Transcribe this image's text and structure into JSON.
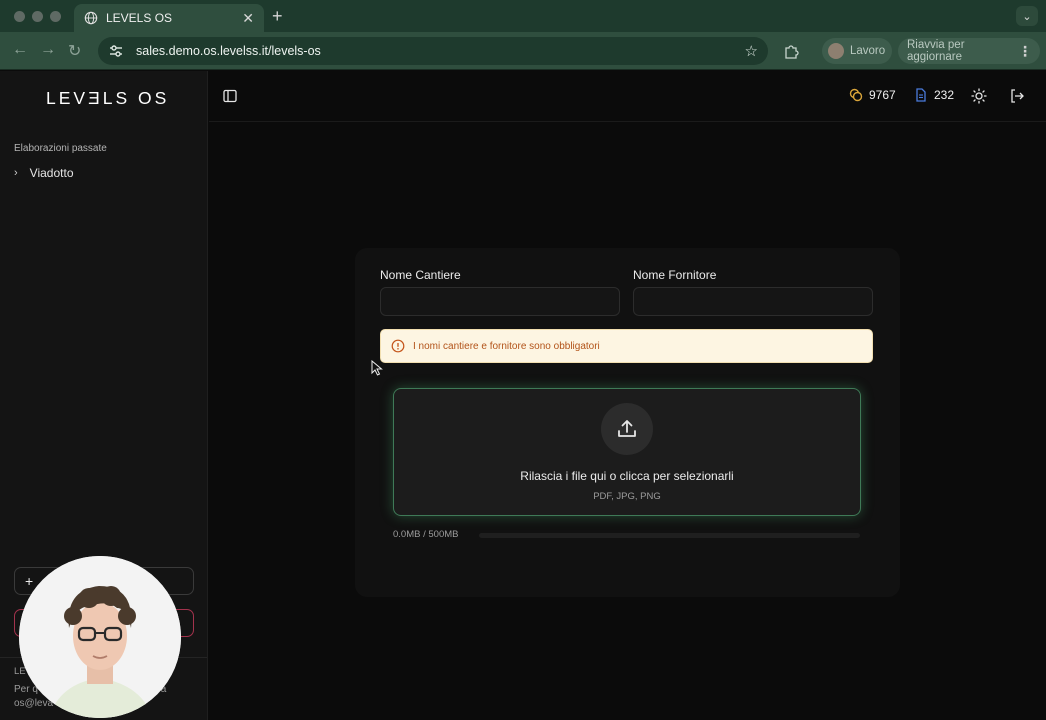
{
  "browser": {
    "tab_title": "LEVELS OS",
    "url": "sales.demo.os.levelss.it/levels-os",
    "profile_label": "Lavoro",
    "relaunch_label": "Riavvia per aggiornare"
  },
  "app": {
    "logo": "LEVƎLS OS",
    "sidebar": {
      "section_title": "Elaborazioni passate",
      "history": [
        {
          "label": "Viadotto"
        }
      ],
      "new_button_label": "",
      "danger_button_label": "",
      "footer_brand": "LE",
      "footer_note_1": "Per q",
      "footer_note_2": "ci a",
      "footer_note_3": "os@leva"
    },
    "topbar": {
      "credits": "9767",
      "documents": "232"
    },
    "form": {
      "site_label": "Nome Cantiere",
      "site_value": "",
      "supplier_label": "Nome Fornitore",
      "supplier_value": "",
      "alert_text": "I nomi cantiere e fornitore sono obbligatori",
      "dropzone_title": "Rilascia i file qui o clicca per selezionarli",
      "dropzone_formats": "PDF, JPG, PNG",
      "quota_text": "0.0MB / 500MB",
      "quota_used_fraction": 0
    }
  },
  "colors": {
    "accent_green": "#3f7a57",
    "alert_bg": "#fdf5e2",
    "alert_text": "#b25319",
    "danger": "#a3334d",
    "credits_icon": "#d9a53a",
    "docs_icon": "#4a7bdc"
  },
  "icons": [
    "globe-icon",
    "tune-icon",
    "star-icon",
    "extensions-icon",
    "sidebar-toggle-icon",
    "coins-icon",
    "document-icon",
    "sun-icon",
    "logout-icon",
    "info-icon",
    "upload-icon",
    "chevron-right-icon",
    "plus-icon"
  ]
}
